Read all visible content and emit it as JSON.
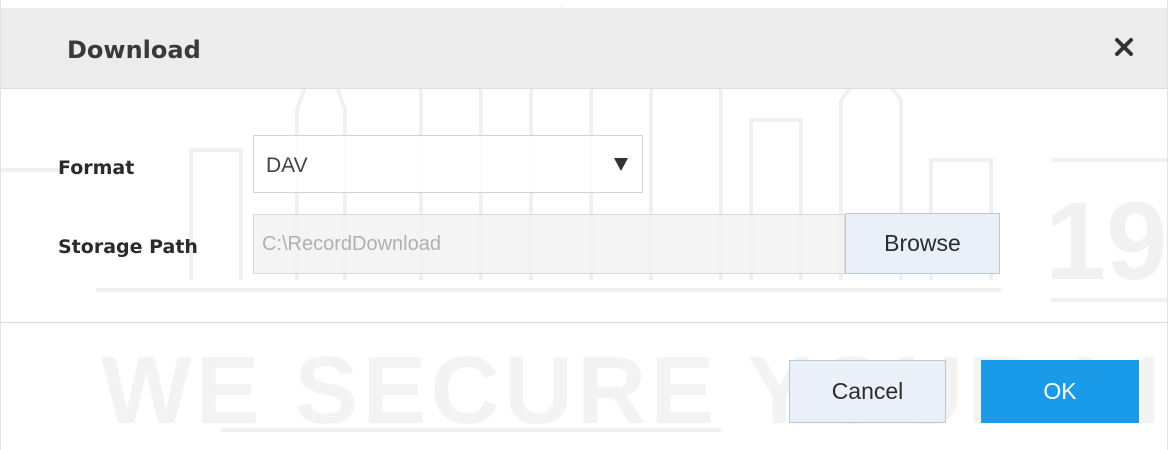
{
  "dialog": {
    "title": "Download",
    "close_icon": "close-icon"
  },
  "form": {
    "format_label": "Format",
    "format_value": "DAV",
    "storage_path_label": "Storage Path",
    "storage_path_value": "C:\\RecordDownload",
    "browse_label": "Browse"
  },
  "footer": {
    "cancel_label": "Cancel",
    "ok_label": "OK"
  },
  "watermark": {
    "slogan": "WE SECURE YOUR LIFE",
    "number": "19"
  },
  "colors": {
    "accent": "#1a9bea",
    "title_bar_bg": "#ececec",
    "secondary_button_bg": "#eaf0f7"
  }
}
